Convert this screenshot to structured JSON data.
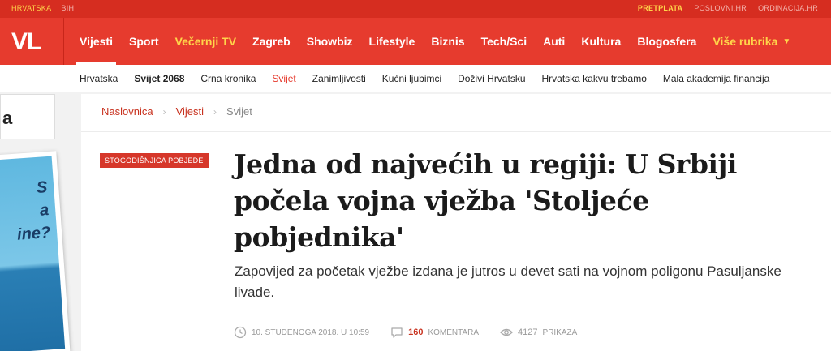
{
  "topbar": {
    "left": [
      "HRVATSKA",
      "BIH"
    ],
    "right": [
      "PRETPLATA",
      "POSLOVNI.HR",
      "ORDINACIJA.HR"
    ]
  },
  "logo": "VL",
  "nav": {
    "items": [
      {
        "label": "Vijesti",
        "active": true
      },
      {
        "label": "Sport"
      },
      {
        "label": "Večernji TV",
        "yellow": true
      },
      {
        "label": "Zagreb"
      },
      {
        "label": "Showbiz"
      },
      {
        "label": "Lifestyle"
      },
      {
        "label": "Biznis"
      },
      {
        "label": "Tech/Sci"
      },
      {
        "label": "Auti"
      },
      {
        "label": "Kultura"
      },
      {
        "label": "Blogosfera"
      }
    ],
    "more_label": "Više rubrika"
  },
  "subnav": {
    "items": [
      "Hrvatska",
      "Svijet 2068",
      "Crna kronika",
      "Svijet",
      "Zanimljivosti",
      "Kućni ljubimci",
      "Doživi Hrvatsku",
      "Hrvatska kakvu trebamo",
      "Mala akademija financija"
    ]
  },
  "sidebar": {
    "box_text": "a",
    "ad_text": [
      "S",
      "a",
      "ine?"
    ]
  },
  "breadcrumb": [
    "Naslovnica",
    "Vijesti",
    "Svijet"
  ],
  "article": {
    "badge": "Stogodišnjica pobjede",
    "headline_lines": [
      "Jedna od najvećih u regiji: U Srbiji",
      "počela vojna vježba 'Stoljeće",
      "pobjednika'"
    ],
    "lead": "Zapovijed za početak vježbe izdana je jutros u devet sati na vojnom poligonu Pasuljanske livade.",
    "date": "10. Studenoga 2018. u 10:59",
    "comments_count": "160",
    "comments_label": "Komentara",
    "views_count": "4127",
    "views_label": "Prikaza"
  },
  "colors": {
    "brand_red": "#e63b2e",
    "topbar_red": "#d62d20",
    "accent_yellow": "#ffd54a"
  }
}
